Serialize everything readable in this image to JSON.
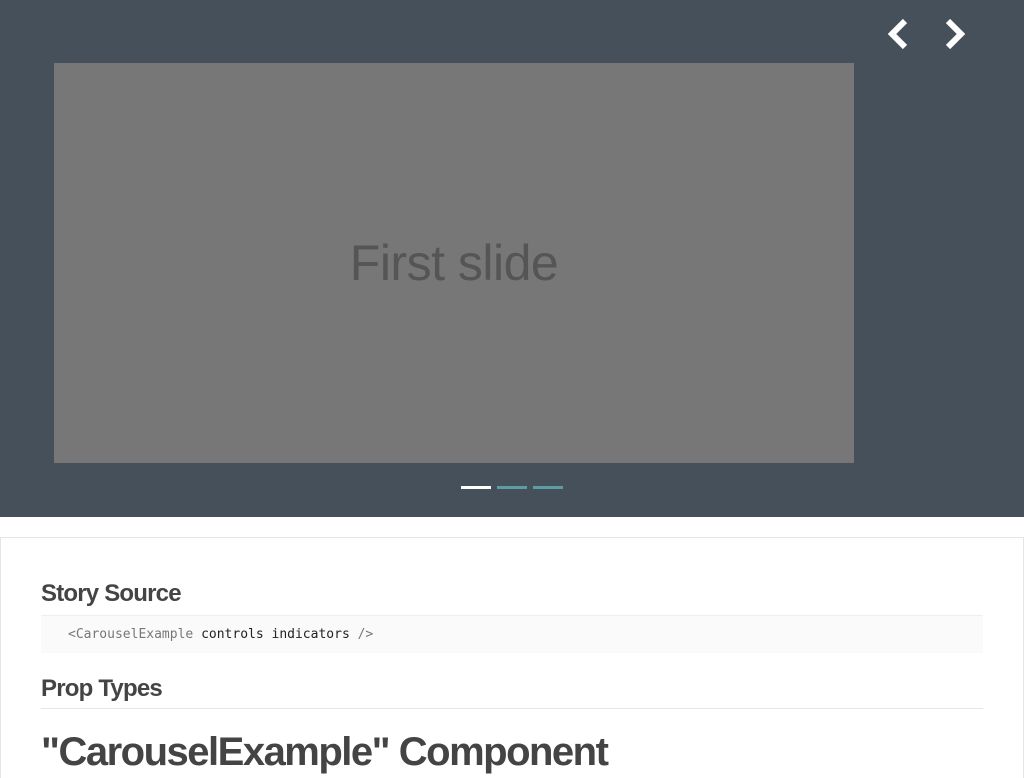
{
  "carousel": {
    "slide_text": "First slide",
    "prev_icon": "chevron-left-icon",
    "next_icon": "chevron-right-icon",
    "indicators": [
      {
        "active": true
      },
      {
        "active": false
      },
      {
        "active": false
      }
    ],
    "colors": {
      "background": "#46505a",
      "slide": "#777777",
      "indicator_active": "#ffffff",
      "indicator_inactive": "#5a9ea3"
    }
  },
  "docs": {
    "story_source_heading": "Story Source",
    "code": {
      "open": "<CarouselExample ",
      "attrs": "controls indicators",
      "close": " />"
    },
    "prop_types_heading": "Prop Types",
    "component_heading": "\"CarouselExample\" Component"
  }
}
